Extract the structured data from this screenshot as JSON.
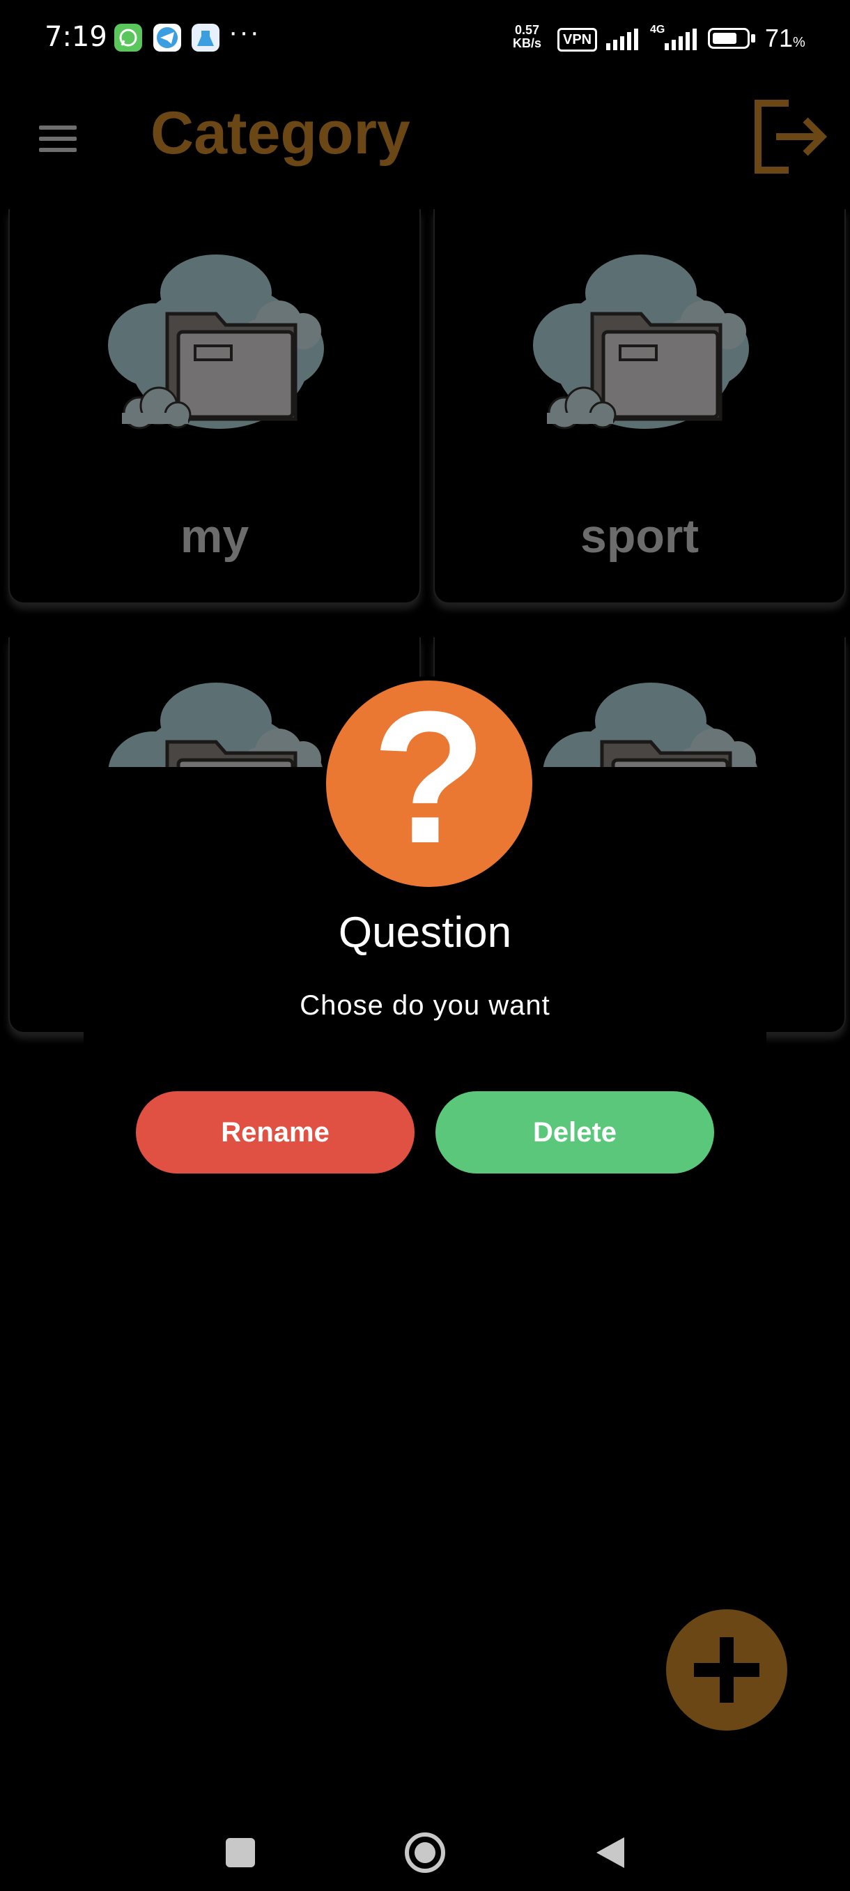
{
  "status_bar": {
    "time": "7:19",
    "more": "···",
    "speed_value": "0.57",
    "speed_unit": "KB/s",
    "vpn": "VPN",
    "network": "4G",
    "battery_pct": "71",
    "battery_symbol": "%",
    "battery_level": 0.71,
    "notification_icons": [
      "whatsapp-icon",
      "telegram-icon",
      "cleaner-app-icon"
    ]
  },
  "app_bar": {
    "title": "Category",
    "menu_icon": "hamburger-menu-icon",
    "logout_icon": "logout-icon"
  },
  "categories": [
    {
      "label": "my"
    },
    {
      "label": "sport"
    },
    {
      "label": ""
    },
    {
      "label": ""
    }
  ],
  "dialog": {
    "icon": "question-mark-icon",
    "icon_glyph": "?",
    "title": "Question",
    "message": "Chose do you want",
    "rename_label": "Rename",
    "delete_label": "Delete"
  },
  "fab": {
    "icon": "plus-icon"
  },
  "nav_bar": {
    "items": [
      "recents-button",
      "home-button",
      "back-button"
    ]
  },
  "colors": {
    "accent_brown": "#6b4716",
    "question_orange": "#eb7832",
    "rename_red": "#e05043",
    "delete_green": "#5ac77b"
  }
}
